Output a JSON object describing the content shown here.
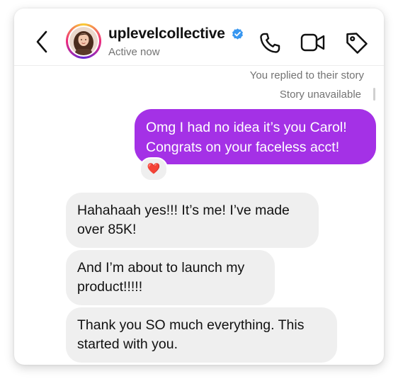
{
  "header": {
    "username": "uplevelcollective",
    "status": "Active now",
    "icons": [
      "back-icon",
      "verified-badge-icon",
      "phone-icon",
      "video-icon",
      "tag-icon"
    ],
    "verified_color": "#3897f0"
  },
  "thread": {
    "story_reply_note": "You replied to their story",
    "story_status": "Story unavailable",
    "messages": [
      {
        "direction": "outgoing",
        "lines": [
          "Omg I had no idea it’s you Carol!",
          "Congrats on your faceless acct!"
        ],
        "reaction": "❤️",
        "color": "#a431e6"
      },
      {
        "direction": "incoming",
        "lines": [
          "Hahahaah yes!!! It’s me! I’ve made",
          "over 85K!"
        ]
      },
      {
        "direction": "incoming",
        "lines": [
          "And I’m about to launch my",
          "product!!!!!"
        ]
      },
      {
        "direction": "incoming",
        "lines": [
          "Thank you SO much everything. This",
          "started with you."
        ]
      }
    ]
  }
}
